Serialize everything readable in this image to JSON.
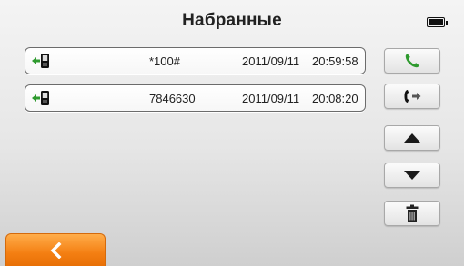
{
  "header": {
    "title": "Набранные"
  },
  "status": {
    "battery_icon": "battery-full-icon"
  },
  "calls": [
    {
      "direction_icon": "outgoing-call-icon",
      "number": "*100#",
      "date": "2011/09/11",
      "time": "20:59:58"
    },
    {
      "direction_icon": "outgoing-call-icon",
      "number": "7846630",
      "date": "2011/09/11",
      "time": "20:08:20"
    }
  ],
  "side_buttons": [
    {
      "icon": "phone-call-icon"
    },
    {
      "icon": "transfer-call-icon"
    },
    {
      "icon": "arrow-up-icon"
    },
    {
      "icon": "arrow-down-icon"
    },
    {
      "icon": "trash-icon"
    }
  ],
  "footer": {
    "back_icon": "chevron-left-icon"
  },
  "colors": {
    "accent_orange": "#f47f12",
    "call_green": "#2e9a2e",
    "row_border": "#6c6c6c"
  }
}
